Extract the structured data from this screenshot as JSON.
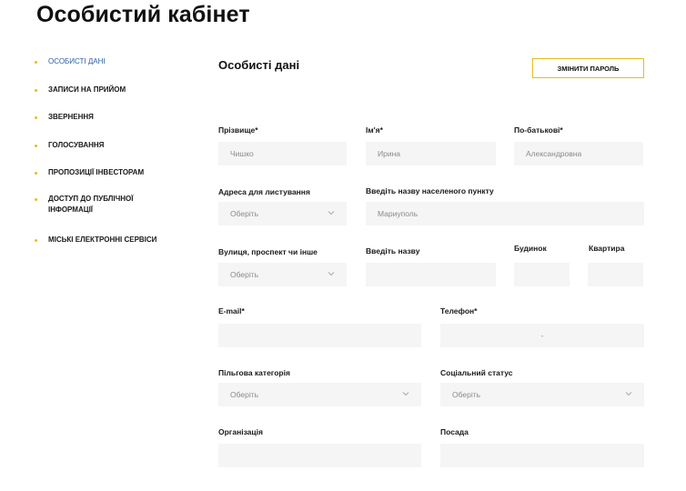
{
  "page_title": "Особистий кабінет",
  "sidebar": {
    "items": [
      {
        "label": "Особисті дані",
        "active": true
      },
      {
        "label": "Записи на прийом"
      },
      {
        "label": "Звернення"
      },
      {
        "label": "Голосування"
      },
      {
        "label": "Пропозиції інвесторам"
      },
      {
        "label": "Доступ до публічної інформації"
      },
      {
        "label": "Міські електронні сервіси"
      }
    ]
  },
  "section": {
    "title": "Особисті дані",
    "change_password_label": "Змінити пароль"
  },
  "form": {
    "surname": {
      "label": "Прізвище*",
      "value": "Чишко"
    },
    "name": {
      "label": "Ім'я*",
      "value": "Ирина"
    },
    "patronymic": {
      "label": "По-батькові*",
      "value": "Александровна"
    },
    "mailing_address": {
      "label": "Адреса для листування",
      "value": "Оберіть"
    },
    "settlement": {
      "label": "Введіть назву населеного пункту",
      "value": "Мариуполь"
    },
    "street_type": {
      "label": "Вулиця, проспект чи інше",
      "value": "Оберіть"
    },
    "street_name": {
      "label": "Введіть назву",
      "value": ""
    },
    "building": {
      "label": "Будинок",
      "value": ""
    },
    "apartment": {
      "label": "Квартира",
      "value": ""
    },
    "email": {
      "label": "E-mail*",
      "value": ""
    },
    "phone": {
      "label": "Телефон*",
      "value": "-"
    },
    "benefit_category": {
      "label": "Пільгова категорія",
      "value": "Оберіть"
    },
    "social_status": {
      "label": "Соціальний статус",
      "value": "Оберіть"
    },
    "organization": {
      "label": "Організація",
      "value": ""
    },
    "position": {
      "label": "Посада",
      "value": ""
    }
  },
  "colors": {
    "accent": "#e6bd1e",
    "active_link": "#2f5fa8",
    "field_bg": "#f5f5f5"
  }
}
